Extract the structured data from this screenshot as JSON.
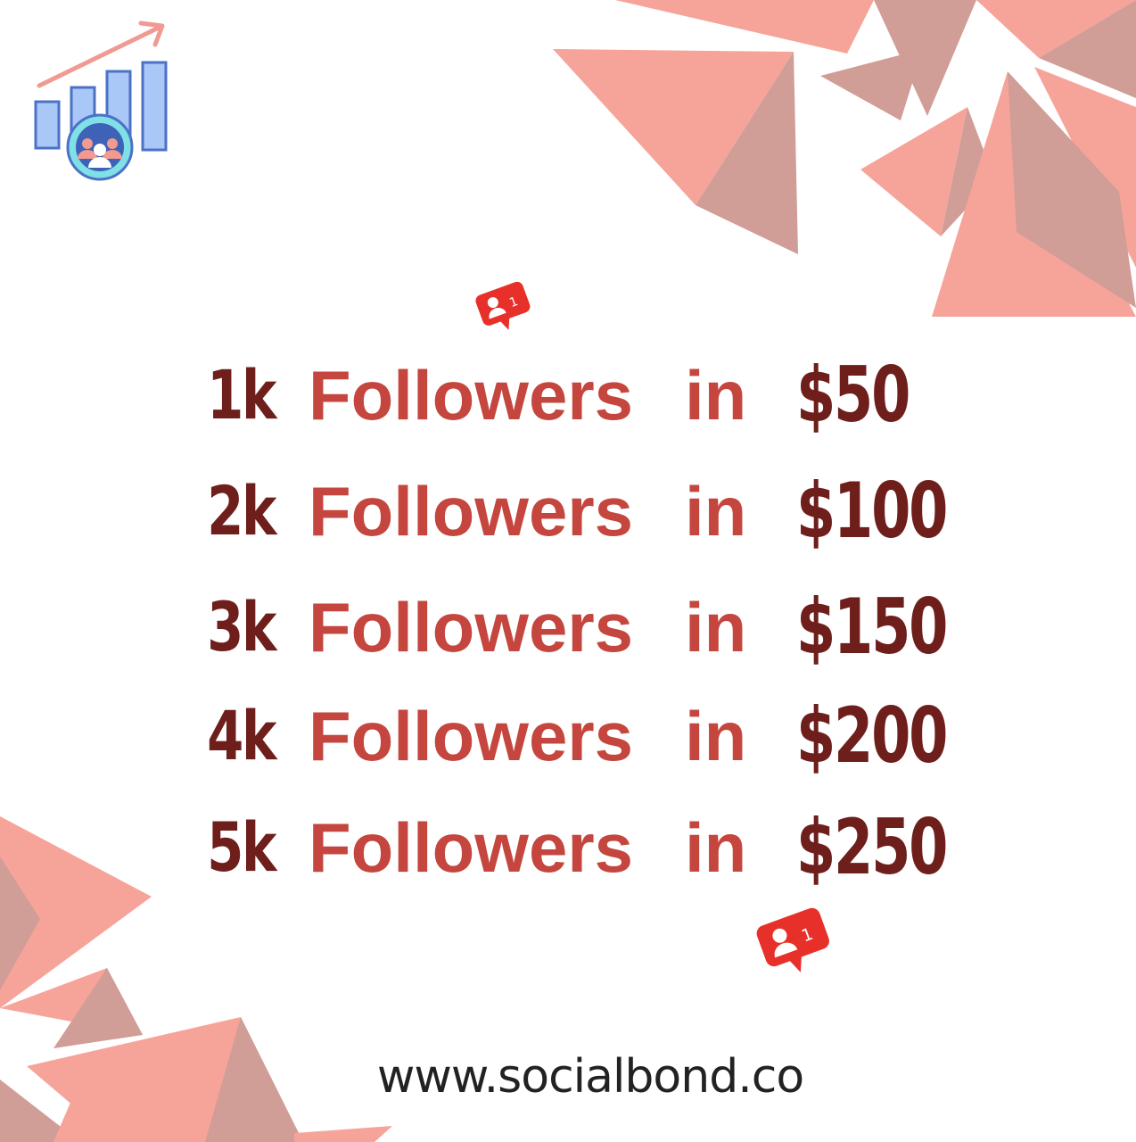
{
  "brand_colors": {
    "dark_red": "#6e1f1c",
    "red": "#c4463e",
    "salmon": "#f6a49a",
    "mauve": "#d09d97",
    "badge_red": "#e8302a"
  },
  "icons": {
    "logo": "growth-chart-with-people-icon",
    "badge": "new-follower-notification-icon"
  },
  "offers": [
    {
      "amount": "1k",
      "word": "Followers",
      "prep": "in",
      "price": "$50"
    },
    {
      "amount": "2k",
      "word": "Followers",
      "prep": "in",
      "price": "$100"
    },
    {
      "amount": "3k",
      "word": "Followers",
      "prep": "in",
      "price": "$150"
    },
    {
      "amount": "4k",
      "word": "Followers",
      "prep": "in",
      "price": "$200"
    },
    {
      "amount": "5k",
      "word": "Followers",
      "prep": "in",
      "price": "$250"
    }
  ],
  "badge_count": "1",
  "website": "www.socialbond.co"
}
